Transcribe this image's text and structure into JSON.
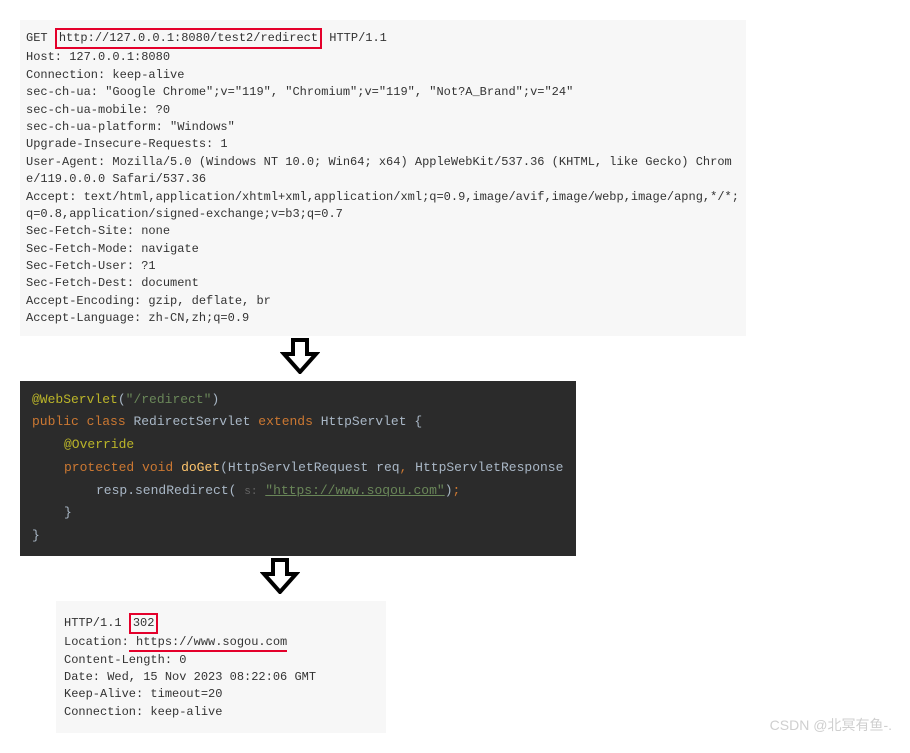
{
  "request": {
    "method": "GET",
    "url": "http://127.0.0.1:8080/test2/redirect",
    "httpver": "HTTP/1.1",
    "lines": [
      "Host: 127.0.0.1:8080",
      "Connection: keep-alive",
      "sec-ch-ua: \"Google Chrome\";v=\"119\", \"Chromium\";v=\"119\", \"Not?A_Brand\";v=\"24\"",
      "sec-ch-ua-mobile: ?0",
      "sec-ch-ua-platform: \"Windows\"",
      "Upgrade-Insecure-Requests: 1",
      "User-Agent: Mozilla/5.0 (Windows NT 10.0; Win64; x64) AppleWebKit/537.36 (KHTML, like Gecko) Chrome/119.0.0.0 Safari/537.36",
      "Accept: text/html,application/xhtml+xml,application/xml;q=0.9,image/avif,image/webp,image/apng,*/*;q=0.8,application/signed-exchange;v=b3;q=0.7",
      "Sec-Fetch-Site: none",
      "Sec-Fetch-Mode: navigate",
      "Sec-Fetch-User: ?1",
      "Sec-Fetch-Dest: document",
      "Accept-Encoding: gzip, deflate, br",
      "Accept-Language: zh-CN,zh;q=0.9"
    ]
  },
  "code": {
    "annotation": "@WebServlet",
    "annotation_arg": "\"/redirect\"",
    "kw_public": "public",
    "kw_class": "class",
    "classname": "RedirectServlet",
    "kw_extends": "extends",
    "superclass": "HttpServlet",
    "brace_open": "{",
    "override": "@Override",
    "kw_protected": "protected",
    "kw_void": "void",
    "method": "doGet",
    "param1_type": "HttpServletRequest",
    "param1_name": "req",
    "comma": ",",
    "param2_type": "HttpServletResponse",
    "body_prefix": "resp.sendRedirect(",
    "hint": "s:",
    "body_string": "\"https://www.soqou.com\"",
    "body_suffix_paren": ")",
    "body_suffix_semi": ";",
    "brace_close1": "}",
    "brace_close2": "}"
  },
  "response": {
    "httpver": "HTTP/1.1",
    "status": "302",
    "location_label": "Location:",
    "location_value": " https://www.sogou.com",
    "lines": [
      "Content-Length: 0",
      "Date: Wed, 15 Nov 2023 08:22:06 GMT",
      "Keep-Alive: timeout=20",
      "Connection: keep-alive"
    ]
  },
  "watermark": "CSDN @北冥有鱼-."
}
